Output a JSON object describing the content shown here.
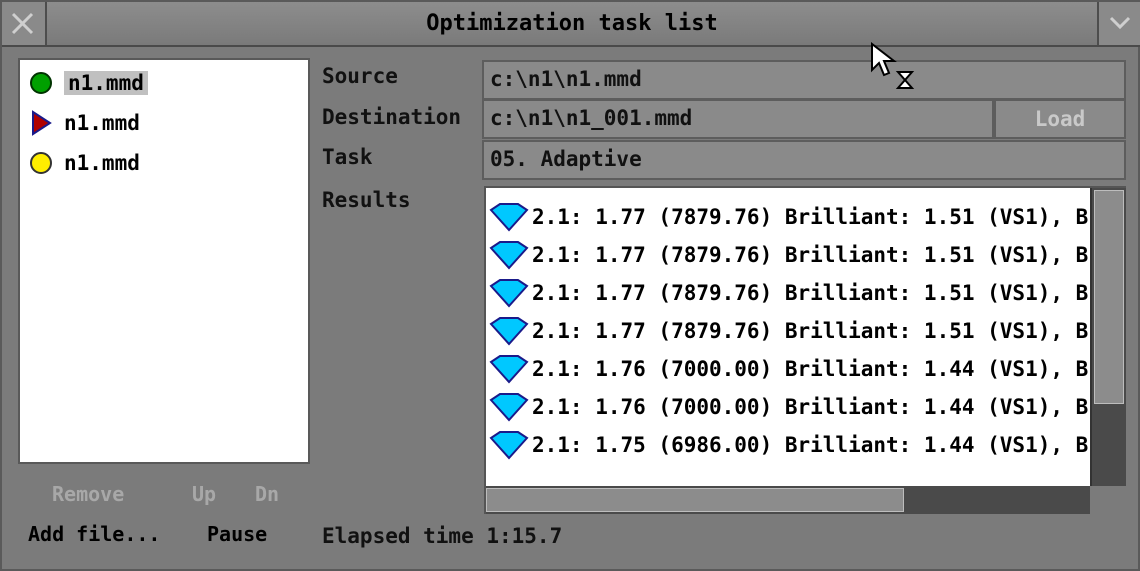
{
  "window": {
    "title": "Optimization task list",
    "close_icon": "close-icon",
    "menu_icon": "chevron-down-icon"
  },
  "files": [
    {
      "name": "n1.mmd",
      "status_icon": "green-circle-icon",
      "selected": true
    },
    {
      "name": "n1.mmd",
      "status_icon": "red-play-icon",
      "selected": false
    },
    {
      "name": "n1.mmd",
      "status_icon": "yellow-circle-icon",
      "selected": false
    }
  ],
  "list_buttons": {
    "remove": "Remove",
    "up": "Up",
    "down": "Dn",
    "add_file": "Add file...",
    "pause": "Pause"
  },
  "form": {
    "source_label": "Source",
    "source_value": "c:\\n1\\n1.mmd",
    "destination_label": "Destination",
    "destination_value": "c:\\n1\\n1_001.mmd",
    "load_label": "Load",
    "task_label": "Task",
    "task_value": "05. Adaptive",
    "results_label": "Results"
  },
  "results": [
    "2.1: 1.77 (7879.76) Brilliant: 1.51 (VS1), B",
    "2.1: 1.77 (7879.76) Brilliant: 1.51 (VS1), B",
    "2.1: 1.77 (7879.76) Brilliant: 1.51 (VS1), B",
    "2.1: 1.77 (7879.76) Brilliant: 1.51 (VS1), B",
    "2.1: 1.76 (7000.00) Brilliant: 1.44 (VS1), B",
    "2.1: 1.76 (7000.00) Brilliant: 1.44 (VS1), B",
    "2.1: 1.75 (6986.00) Brilliant: 1.44 (VS1), B"
  ],
  "elapsed": "Elapsed time 1:15.7",
  "colors": {
    "panel": "#7b7b7b",
    "diamond": "#00c8ff",
    "green": "#00a000",
    "red": "#b00000",
    "yellow": "#ffee00"
  }
}
